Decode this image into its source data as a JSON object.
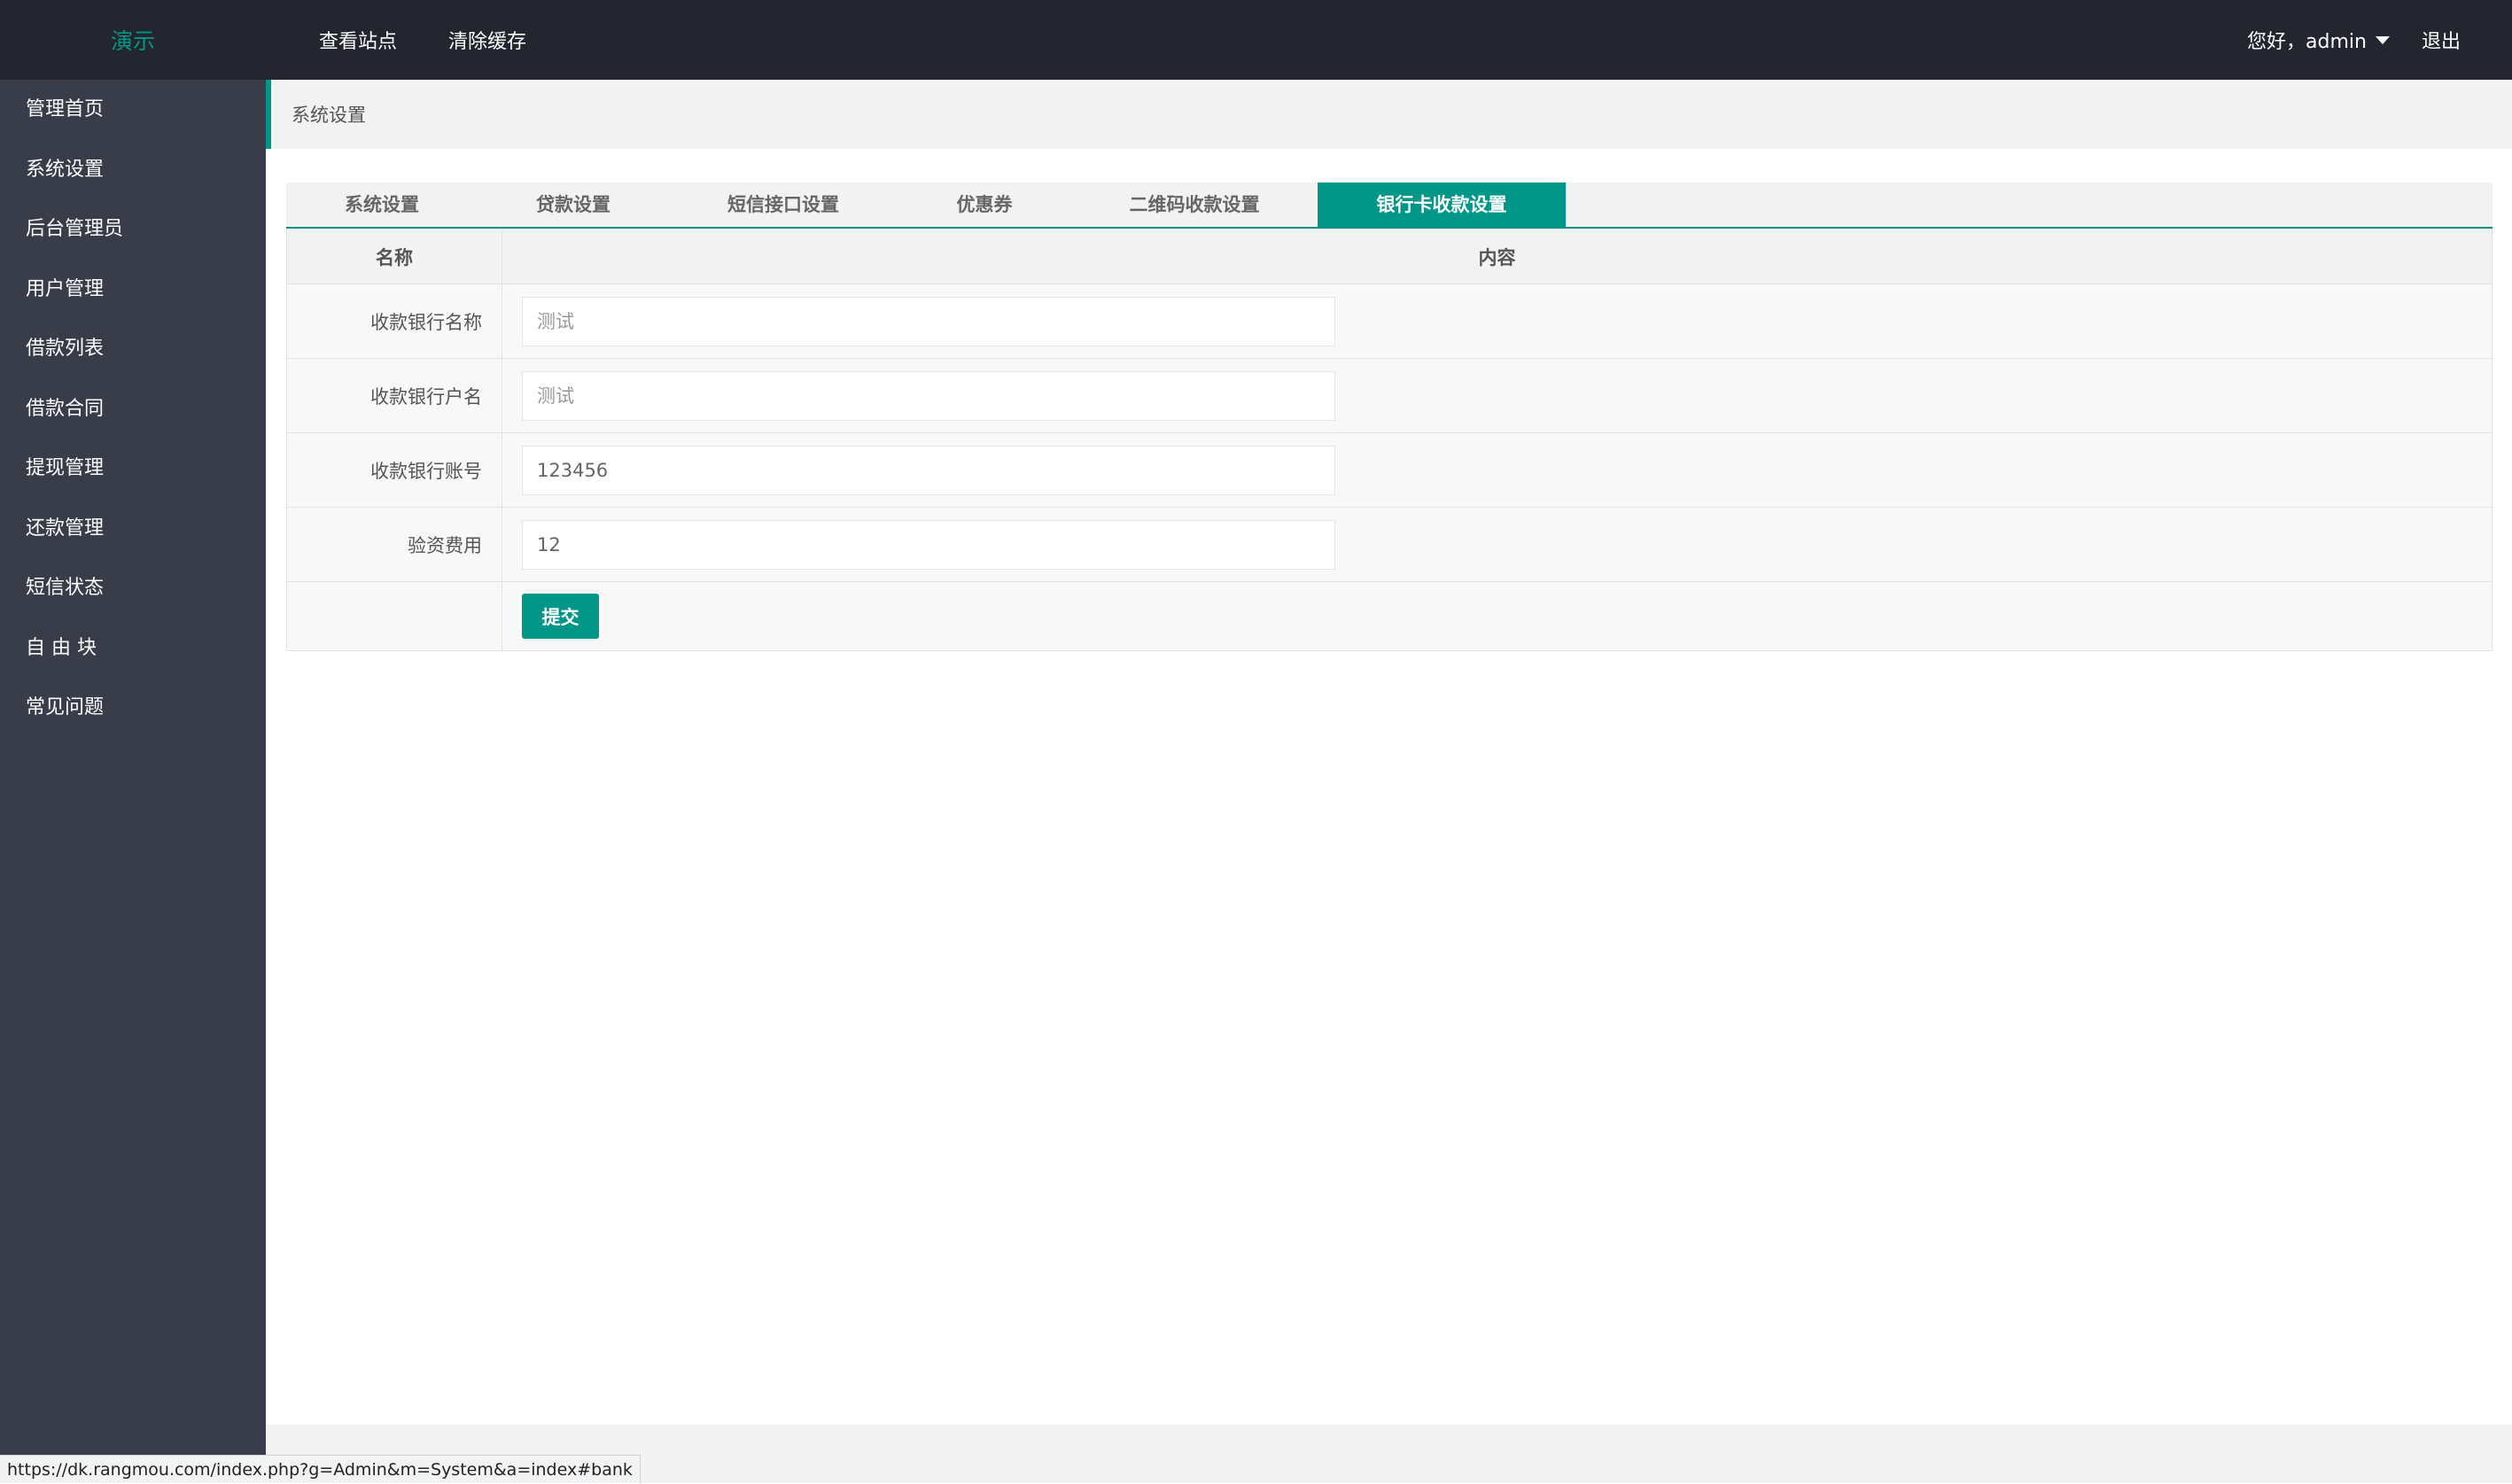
{
  "header": {
    "logo": "演示",
    "nav": [
      "查看站点",
      "清除缓存"
    ],
    "greeting": "您好，admin",
    "logout": "退出"
  },
  "sidebar": {
    "items": [
      "管理首页",
      "系统设置",
      "后台管理员",
      "用户管理",
      "借款列表",
      "借款合同",
      "提现管理",
      "还款管理",
      "短信状态",
      "自 由 块",
      "常见问题"
    ]
  },
  "breadcrumb": "系统设置",
  "tabs": [
    {
      "label": "系统设置"
    },
    {
      "label": "贷款设置"
    },
    {
      "label": "短信接口设置"
    },
    {
      "label": "优惠券"
    },
    {
      "label": "二维码收款设置"
    },
    {
      "label": "银行卡收款设置"
    }
  ],
  "table": {
    "headers": [
      "名称",
      "内容"
    ],
    "rows": [
      {
        "label": "收款银行名称",
        "value": "",
        "placeholder": "测试"
      },
      {
        "label": "收款银行户名",
        "value": "",
        "placeholder": "测试"
      },
      {
        "label": "收款银行账号",
        "value": "123456",
        "placeholder": ""
      },
      {
        "label": "验资费用",
        "value": "12",
        "placeholder": ""
      }
    ],
    "submit": "提交"
  },
  "statusbar": "https://dk.rangmou.com/index.php?g=Admin&m=System&a=index#bank",
  "colors": {
    "accent": "#009688",
    "header_bg": "#23262e",
    "sidebar_bg": "#393d49"
  }
}
